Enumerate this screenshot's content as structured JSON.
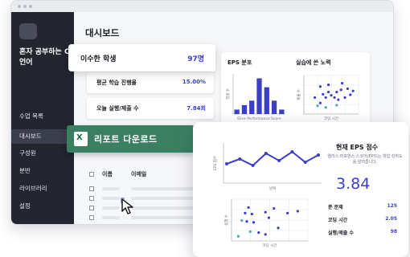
{
  "sidebar": {
    "course_title": "혼자 공부하는 C언어",
    "items": [
      {
        "label": "수업 목록",
        "active": false
      },
      {
        "label": "대시보드",
        "active": true
      },
      {
        "label": "구성원",
        "active": false
      },
      {
        "label": "분반",
        "active": false
      },
      {
        "label": "라이브러리",
        "active": false
      },
      {
        "label": "설정",
        "active": false
      }
    ]
  },
  "main": {
    "title": "대시보드",
    "top_popup": {
      "label": "이수한 학생",
      "value": "97명"
    },
    "stats": [
      {
        "label": "평균 학습 진행율",
        "value": "15.00%"
      },
      {
        "label": "오늘 실행/제출 수",
        "value": "7.84회"
      }
    ],
    "eps_dist_title": "EPS 분포",
    "effort_title": "실습에 쓴 노력",
    "report_button": {
      "icon": "excel-icon",
      "icon_glyph": "X",
      "label": "리포트 다운로드"
    },
    "table": {
      "headers": [
        "이름",
        "이메일"
      ]
    }
  },
  "chart_data": [
    {
      "type": "bar",
      "title": "EPS 분포",
      "xlabel": "Elice Performance Score",
      "ylabel": "학생 수",
      "values": [
        1,
        2,
        3,
        8,
        6,
        3,
        1
      ],
      "ylim": [
        0,
        9
      ],
      "color": "#3b3fc8"
    },
    {
      "type": "scatter",
      "title": "실습에 쓴 노력",
      "xlabel": "코딩 시간",
      "ylabel": "제출 수",
      "points_series1": [
        [
          2,
          3
        ],
        [
          3,
          2
        ],
        [
          3.5,
          3.6
        ],
        [
          4,
          3
        ],
        [
          4.5,
          4
        ],
        [
          5,
          3.4
        ],
        [
          5.6,
          3
        ],
        [
          6,
          4
        ],
        [
          6.3,
          2.6
        ],
        [
          6.8,
          4.4
        ],
        [
          7.5,
          3
        ],
        [
          8,
          4.6
        ],
        [
          8.5,
          3.5
        ],
        [
          9,
          4.2
        ],
        [
          3,
          5
        ],
        [
          4.5,
          5.3
        ],
        [
          7,
          5.6
        ]
      ],
      "points_series2": [
        [
          2.5,
          1.5
        ],
        [
          4,
          1.2
        ],
        [
          6,
          1.6
        ]
      ],
      "xlim": [
        0,
        10
      ],
      "ylim": [
        0,
        7
      ],
      "grid": true,
      "colors": [
        "#3b3fc8",
        "#4aa8b8"
      ]
    },
    {
      "type": "line",
      "title": "",
      "xlabel": "날짜",
      "ylabel": "EPS 점수",
      "values": [
        2.4,
        3.0,
        2.2,
        3.7,
        2.8,
        3.9,
        2.6,
        3.5
      ],
      "ylim": [
        0,
        5
      ],
      "color": "#3b3fc8"
    },
    {
      "type": "scatter",
      "title": "",
      "xlabel": "코딩 시간",
      "ylabel": "실행 수",
      "points_series1": [
        [
          1.6,
          6
        ],
        [
          2,
          7.2
        ],
        [
          2.4,
          5.8
        ],
        [
          1.8,
          4.2
        ],
        [
          2.6,
          4
        ],
        [
          4,
          6.2
        ],
        [
          4.4,
          5
        ],
        [
          5,
          7
        ],
        [
          6.6,
          6
        ],
        [
          7.8,
          6.4
        ],
        [
          3.2,
          1.8
        ],
        [
          4,
          1.4
        ],
        [
          5.5,
          2.8
        ]
      ],
      "points_series2": [
        [
          1.2,
          4.4
        ],
        [
          2.2,
          2
        ],
        [
          0.8,
          1
        ]
      ],
      "xlim": [
        0,
        9
      ],
      "ylim": [
        0,
        9
      ],
      "grid": true,
      "colors": [
        "#3b3fc8",
        "#4aa8b8"
      ]
    }
  ],
  "eps_popup": {
    "title": "현재 EPS 점수",
    "subtitle": "엘리스 퍼포먼스 스코어(EPS)는 학업 성취도를 알려줍니다.",
    "value": "3.84",
    "rows": [
      {
        "label": "푼 문제",
        "value": "125"
      },
      {
        "label": "코딩 시간",
        "value": "2.05"
      },
      {
        "label": "실행/제출 수",
        "value": "98"
      }
    ]
  }
}
